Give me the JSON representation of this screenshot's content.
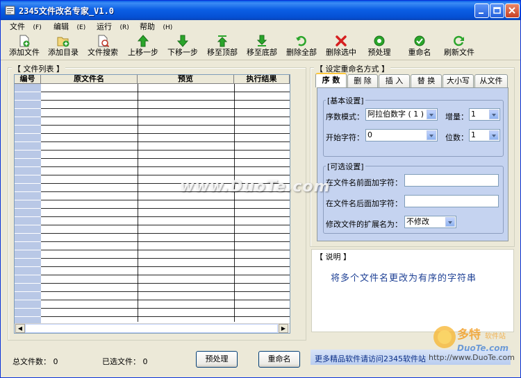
{
  "window": {
    "title": "2345文件改名专家_V1.0"
  },
  "menu": [
    {
      "label": "文件",
      "key": "(F)"
    },
    {
      "label": "编辑",
      "key": "(E)"
    },
    {
      "label": "运行",
      "key": "(R)"
    },
    {
      "label": "帮助",
      "key": "(H)"
    }
  ],
  "toolbar": [
    {
      "label": "添加文件",
      "icon": "add-file-icon",
      "color": "#2e9e2e"
    },
    {
      "label": "添加目录",
      "icon": "add-folder-icon",
      "color": "#2e9e2e"
    },
    {
      "label": "文件搜索",
      "icon": "file-search-icon",
      "color": "#c0392b"
    },
    {
      "label": "上移一步",
      "icon": "arrow-up-icon",
      "color": "#2aa52a"
    },
    {
      "label": "下移一步",
      "icon": "arrow-down-icon",
      "color": "#2aa52a"
    },
    {
      "label": "移至顶部",
      "icon": "move-top-icon",
      "color": "#2aa52a"
    },
    {
      "label": "移至底部",
      "icon": "move-bottom-icon",
      "color": "#2aa52a"
    },
    {
      "label": "删除全部",
      "icon": "delete-all-icon",
      "color": "#2aa52a"
    },
    {
      "label": "删除选中",
      "icon": "delete-selected-icon",
      "color": "#d62020"
    },
    {
      "label": "预处理",
      "icon": "preprocess-icon",
      "color": "#2aa52a"
    },
    {
      "label": "重命名",
      "icon": "rename-check-icon",
      "color": "#2aa52a"
    },
    {
      "label": "刷新文件",
      "icon": "refresh-icon",
      "color": "#2aa52a"
    }
  ],
  "file_list": {
    "legend": "【 文件列表 】",
    "columns": [
      "编号",
      "原文件名",
      "预览",
      "执行结果"
    ],
    "rows": []
  },
  "rename_settings": {
    "legend": "【 设定重命名方式 】",
    "tabs": [
      "序 数",
      "删 除",
      "插 入",
      "替 换",
      "大小写",
      "从文件"
    ],
    "active_tab": "序 数",
    "basic": {
      "legend": "[基本设置]",
      "seq_mode_label": "序数模式：",
      "seq_mode_value": "阿拉伯数字 ( 1 )",
      "increment_label": "增量：",
      "increment_value": "1",
      "start_label": "开始字符：",
      "start_value": "0",
      "digits_label": "位数：",
      "digits_value": "1"
    },
    "optional": {
      "legend": "[可选设置]",
      "prefix_label": "在文件名前面加字符：",
      "prefix_value": "",
      "suffix_label": "在文件名后面加字符：",
      "suffix_value": "",
      "ext_label": "修改文件的扩展名为：",
      "ext_value": "不修改"
    }
  },
  "description": {
    "legend": "【 说明 】",
    "text": "将多个文件名更改为有序的字符串"
  },
  "status": {
    "total_label": "总文件数：",
    "total_value": "0",
    "selected_label": "已选文件：",
    "selected_value": "0",
    "preprocess_button": "预处理",
    "rename_button": "重命名"
  },
  "promo": {
    "text": "更多精品软件请访问2345软件站",
    "url": "http://www.DuoTe.com"
  },
  "watermark": "www.DuoTe.com"
}
